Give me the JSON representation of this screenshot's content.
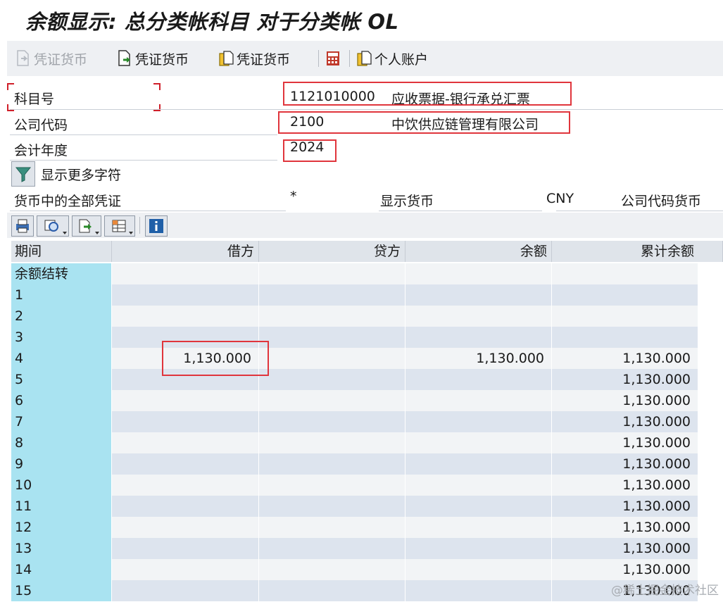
{
  "window": {
    "title": "余额显示: 总分类帐科目 对于分类帐 OL"
  },
  "toolbar": {
    "items": [
      {
        "label": "凭证货币",
        "enabled": false
      },
      {
        "label": "凭证货币",
        "enabled": true
      },
      {
        "label": "凭证货币",
        "enabled": true
      },
      {
        "label": "个人账户",
        "enabled": true
      }
    ]
  },
  "form": {
    "account_label": "科目号",
    "account_value": "1121010000",
    "account_desc": "应收票据-银行承兑汇票",
    "company_label": "公司代码",
    "company_value": "2100",
    "company_desc": "中饮供应链管理有限公司",
    "year_label": "会计年度",
    "year_value": "2024",
    "more_label": "显示更多字符",
    "currency_all_label": "货币中的全部凭证",
    "currency_all_value": "*",
    "display_currency_label": "显示货币",
    "display_currency_value": "CNY",
    "company_currency_label": "公司代码货币"
  },
  "grid": {
    "headers": [
      "期间",
      "借方",
      "贷方",
      "余额",
      "累计余额"
    ],
    "rows": [
      {
        "period": "余额结转",
        "debit": "",
        "credit": "",
        "balance": "",
        "cumulative": ""
      },
      {
        "period": "1",
        "debit": "",
        "credit": "",
        "balance": "",
        "cumulative": ""
      },
      {
        "period": "2",
        "debit": "",
        "credit": "",
        "balance": "",
        "cumulative": ""
      },
      {
        "period": "3",
        "debit": "",
        "credit": "",
        "balance": "",
        "cumulative": ""
      },
      {
        "period": "4",
        "debit": "1,130.000",
        "credit": "",
        "balance": "1,130.000",
        "cumulative": "1,130.000"
      },
      {
        "period": "5",
        "debit": "",
        "credit": "",
        "balance": "",
        "cumulative": "1,130.000"
      },
      {
        "period": "6",
        "debit": "",
        "credit": "",
        "balance": "",
        "cumulative": "1,130.000"
      },
      {
        "period": "7",
        "debit": "",
        "credit": "",
        "balance": "",
        "cumulative": "1,130.000"
      },
      {
        "period": "8",
        "debit": "",
        "credit": "",
        "balance": "",
        "cumulative": "1,130.000"
      },
      {
        "period": "9",
        "debit": "",
        "credit": "",
        "balance": "",
        "cumulative": "1,130.000"
      },
      {
        "period": "10",
        "debit": "",
        "credit": "",
        "balance": "",
        "cumulative": "1,130.000"
      },
      {
        "period": "11",
        "debit": "",
        "credit": "",
        "balance": "",
        "cumulative": "1,130.000"
      },
      {
        "period": "12",
        "debit": "",
        "credit": "",
        "balance": "",
        "cumulative": "1,130.000"
      },
      {
        "period": "13",
        "debit": "",
        "credit": "",
        "balance": "",
        "cumulative": "1,130.000"
      },
      {
        "period": "14",
        "debit": "",
        "credit": "",
        "balance": "",
        "cumulative": "1,130.000"
      },
      {
        "period": "15",
        "debit": "",
        "credit": "",
        "balance": "",
        "cumulative": "1,130.000"
      }
    ]
  },
  "watermark": "@稀土掘金技术社区",
  "colors": {
    "highlight": "#e0353c",
    "period_cell": "#a9e3f1",
    "row_even": "#dde4ee",
    "row_odd": "#f2f4f6"
  }
}
